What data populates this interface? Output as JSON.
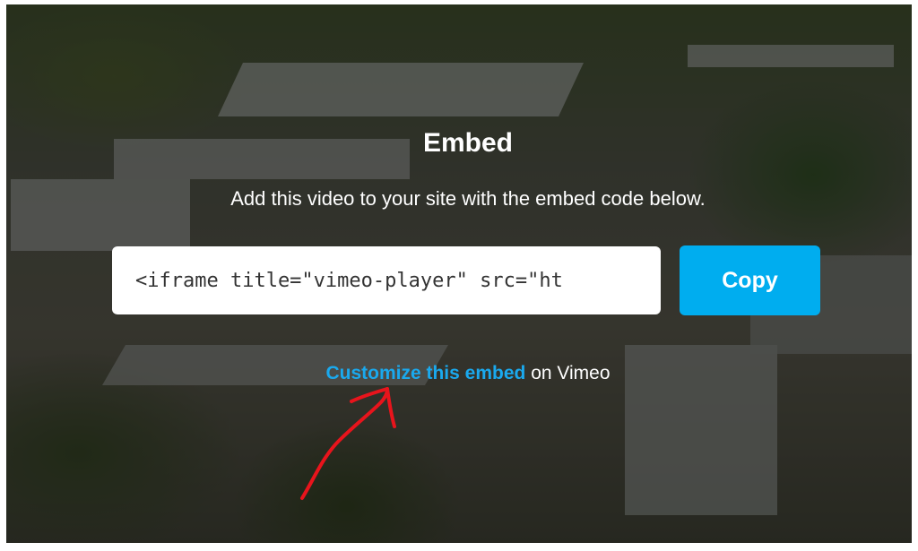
{
  "embed": {
    "title": "Embed",
    "subtitle": "Add this video to your site with the embed code below.",
    "code_value": "<iframe title=\"vimeo-player\" src=\"ht",
    "copy_label": "Copy",
    "customize_link": "Customize this embed",
    "customize_suffix": "on Vimeo"
  },
  "colors": {
    "accent": "#00adef",
    "link": "#1aa9ee",
    "annotation": "#e8141c"
  },
  "icons": {
    "annotation": "red-arrow-icon"
  }
}
